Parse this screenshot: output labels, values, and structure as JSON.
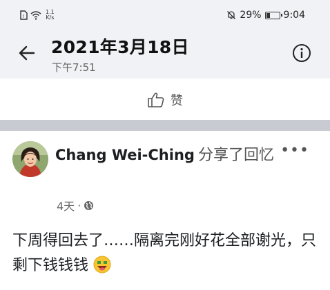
{
  "status_bar": {
    "network_speed": "1.1",
    "network_unit": "K/s",
    "battery_percent": "29%",
    "battery_level": 0.29,
    "time": "9:04"
  },
  "header": {
    "title": "2021年3月18日",
    "subtitle": "下午7:51"
  },
  "actions": {
    "like_label": "赞"
  },
  "post": {
    "author": "Chang Wei-Ching",
    "action_text": "分享了回忆",
    "time_ago": "4天",
    "separator": "·",
    "body": "下周得回去了……隔离完刚好花全部谢光，只剩下钱钱钱",
    "more_label": "•••"
  },
  "colors": {
    "header_bg": "#f0f2f5",
    "section_gap": "#c8ccd2",
    "text_primary": "#1c1e21",
    "text_secondary": "#666666"
  }
}
